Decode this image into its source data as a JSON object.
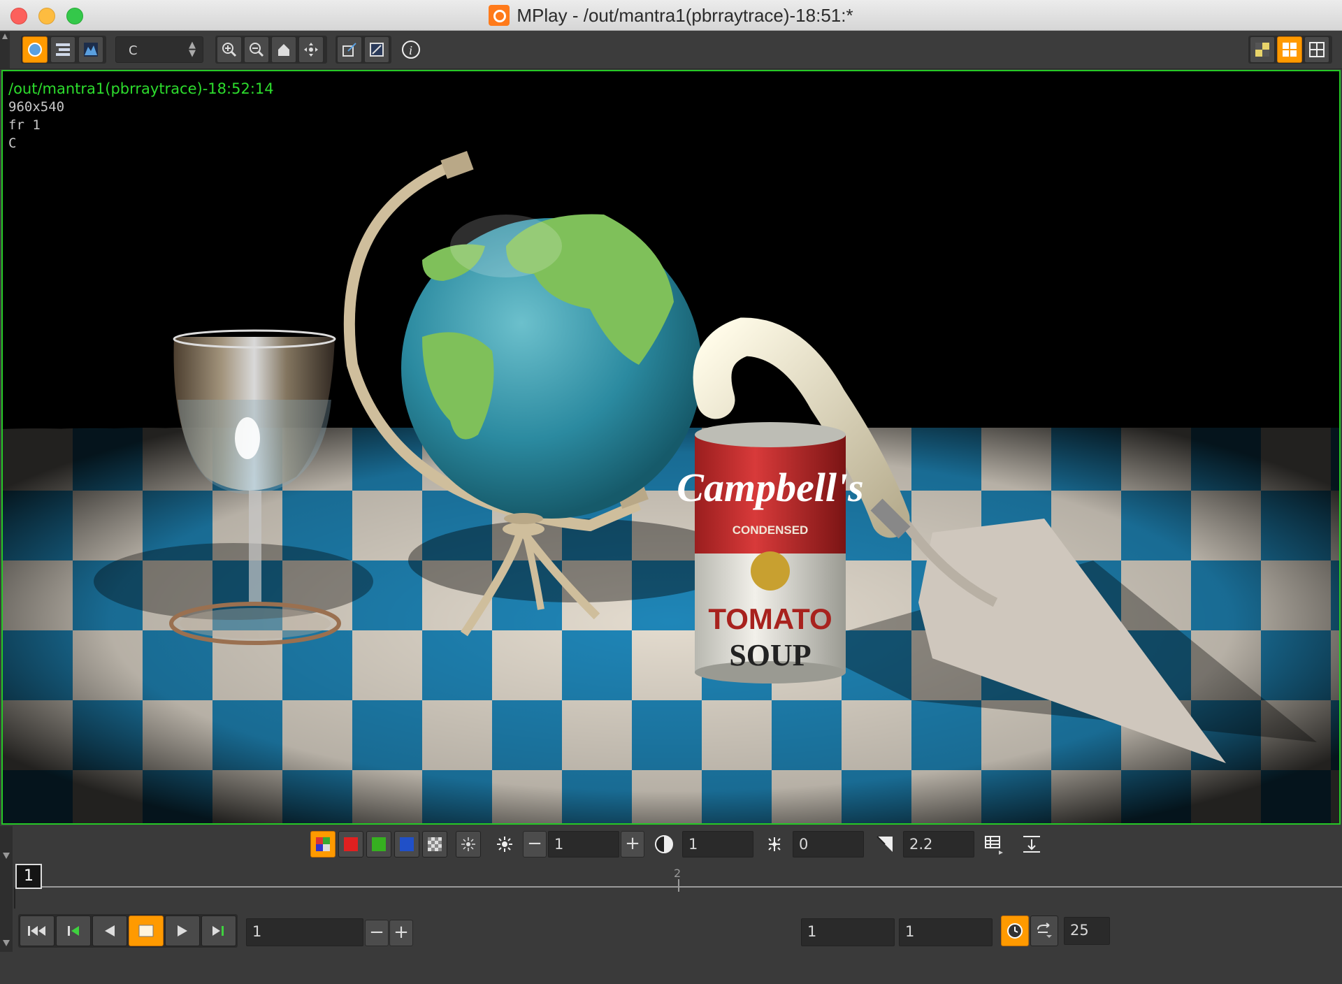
{
  "window": {
    "title": "MPlay - /out/mantra1(pbrraytrace)-18:51:*"
  },
  "toolbar": {
    "channel_select": "C",
    "buttons": [
      "view-mode-icon",
      "layer-list-icon",
      "histogram-icon",
      "zoom-in-icon",
      "zoom-out-icon",
      "home-icon",
      "fit-icon",
      "crop-icon",
      "adjust-icon",
      "info-icon"
    ],
    "right_buttons": [
      "checker-view-icon",
      "grid-layout-icon",
      "quad-layout-icon"
    ]
  },
  "viewport": {
    "path": "/out/mantra1(pbrraytrace)-18:52:14",
    "resolution": "960x540",
    "frame": "fr 1",
    "channel": "C",
    "can_label_brand": "Campbell's",
    "can_label_condensed": "CONDENSED",
    "can_label_tomato": "TOMATO",
    "can_label_soup": "SOUP"
  },
  "display_controls": {
    "exposure_value": "1",
    "gamma_contrast_value": "1",
    "offset_value": "0",
    "gamma_value": "2.2"
  },
  "timeline": {
    "current_frame_marker": "1",
    "tick_label": "2"
  },
  "playback": {
    "frame_field": "1",
    "start_frame": "1",
    "end_frame": "1",
    "fps": "25"
  },
  "colors": {
    "accent": "#ff9a00",
    "viewport_border": "#26c826",
    "path_text": "#2ddc2d"
  }
}
